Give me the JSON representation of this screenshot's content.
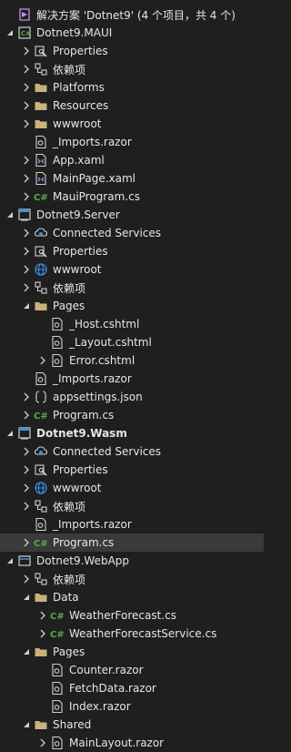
{
  "colors": {
    "background": "#1f1f1f",
    "text": "#e6e6e6",
    "selected": "#3a3a3a",
    "folder": "#c9b27c",
    "csharp": "#5aa84a",
    "globe": "#3c8dde",
    "project": "#4a8fd6"
  },
  "tree": [
    {
      "label": "解决方案 'Dotnet9' (4 个项目，共 4 个)",
      "icon": "solution-icon",
      "toggle": "none",
      "depth": 0
    },
    {
      "label": "Dotnet9.MAUI",
      "icon": "project-icon",
      "toggle": "expanded",
      "depth": 0
    },
    {
      "label": "Properties",
      "icon": "wrench-icon",
      "toggle": "collapsed",
      "depth": 1
    },
    {
      "label": "依赖项",
      "icon": "dependencies-icon",
      "toggle": "collapsed",
      "depth": 1
    },
    {
      "label": "Platforms",
      "icon": "folder-icon",
      "toggle": "collapsed",
      "depth": 1
    },
    {
      "label": "Resources",
      "icon": "folder-icon",
      "toggle": "collapsed",
      "depth": 1
    },
    {
      "label": "wwwroot",
      "icon": "folder-icon",
      "toggle": "collapsed",
      "depth": 1
    },
    {
      "label": "_Imports.razor",
      "icon": "razor-file-icon",
      "toggle": "none",
      "depth": 1
    },
    {
      "label": "App.xaml",
      "icon": "xaml-file-icon",
      "toggle": "collapsed",
      "depth": 1
    },
    {
      "label": "MainPage.xaml",
      "icon": "xaml-file-icon",
      "toggle": "collapsed",
      "depth": 1
    },
    {
      "label": "MauiProgram.cs",
      "icon": "csharp-file-icon",
      "toggle": "collapsed",
      "depth": 1
    },
    {
      "label": "Dotnet9.Server",
      "icon": "web-project-icon",
      "toggle": "expanded",
      "depth": 0
    },
    {
      "label": "Connected Services",
      "icon": "connected-services-icon",
      "toggle": "collapsed",
      "depth": 1
    },
    {
      "label": "Properties",
      "icon": "wrench-icon",
      "toggle": "collapsed",
      "depth": 1
    },
    {
      "label": "wwwroot",
      "icon": "globe-icon",
      "toggle": "collapsed",
      "depth": 1
    },
    {
      "label": "依赖项",
      "icon": "dependencies-icon",
      "toggle": "collapsed",
      "depth": 1
    },
    {
      "label": "Pages",
      "icon": "folder-icon",
      "toggle": "expanded",
      "depth": 1
    },
    {
      "label": "_Host.cshtml",
      "icon": "razor-file-icon",
      "toggle": "none",
      "depth": 2
    },
    {
      "label": "_Layout.cshtml",
      "icon": "razor-file-icon",
      "toggle": "none",
      "depth": 2
    },
    {
      "label": "Error.cshtml",
      "icon": "razor-file-icon",
      "toggle": "collapsed",
      "depth": 2
    },
    {
      "label": "_Imports.razor",
      "icon": "razor-file-icon",
      "toggle": "none",
      "depth": 1
    },
    {
      "label": "appsettings.json",
      "icon": "json-file-icon",
      "toggle": "collapsed",
      "depth": 1
    },
    {
      "label": "Program.cs",
      "icon": "csharp-file-icon",
      "toggle": "collapsed",
      "depth": 1
    },
    {
      "label": "Dotnet9.Wasm",
      "icon": "web-project-icon",
      "toggle": "expanded",
      "depth": 0,
      "bold": true
    },
    {
      "label": "Connected Services",
      "icon": "connected-services-icon",
      "toggle": "collapsed",
      "depth": 1
    },
    {
      "label": "Properties",
      "icon": "wrench-icon",
      "toggle": "collapsed",
      "depth": 1
    },
    {
      "label": "wwwroot",
      "icon": "globe-icon",
      "toggle": "collapsed",
      "depth": 1
    },
    {
      "label": "依赖项",
      "icon": "dependencies-icon",
      "toggle": "collapsed",
      "depth": 1
    },
    {
      "label": "_Imports.razor",
      "icon": "razor-file-icon",
      "toggle": "none",
      "depth": 1
    },
    {
      "label": "Program.cs",
      "icon": "csharp-file-icon",
      "toggle": "collapsed",
      "depth": 1,
      "selected": true
    },
    {
      "label": "Dotnet9.WebApp",
      "icon": "class-library-icon",
      "toggle": "expanded",
      "depth": 0
    },
    {
      "label": "依赖项",
      "icon": "dependencies-icon",
      "toggle": "collapsed",
      "depth": 1
    },
    {
      "label": "Data",
      "icon": "folder-icon",
      "toggle": "expanded",
      "depth": 1
    },
    {
      "label": "WeatherForecast.cs",
      "icon": "csharp-file-icon",
      "toggle": "collapsed",
      "depth": 2
    },
    {
      "label": "WeatherForecastService.cs",
      "icon": "csharp-file-icon",
      "toggle": "collapsed",
      "depth": 2
    },
    {
      "label": "Pages",
      "icon": "folder-icon",
      "toggle": "expanded",
      "depth": 1
    },
    {
      "label": "Counter.razor",
      "icon": "razor-file-icon",
      "toggle": "none",
      "depth": 2
    },
    {
      "label": "FetchData.razor",
      "icon": "razor-file-icon",
      "toggle": "none",
      "depth": 2
    },
    {
      "label": "Index.razor",
      "icon": "razor-file-icon",
      "toggle": "none",
      "depth": 2
    },
    {
      "label": "Shared",
      "icon": "folder-icon",
      "toggle": "expanded",
      "depth": 1
    },
    {
      "label": "MainLayout.razor",
      "icon": "razor-file-icon",
      "toggle": "collapsed",
      "depth": 2
    }
  ]
}
